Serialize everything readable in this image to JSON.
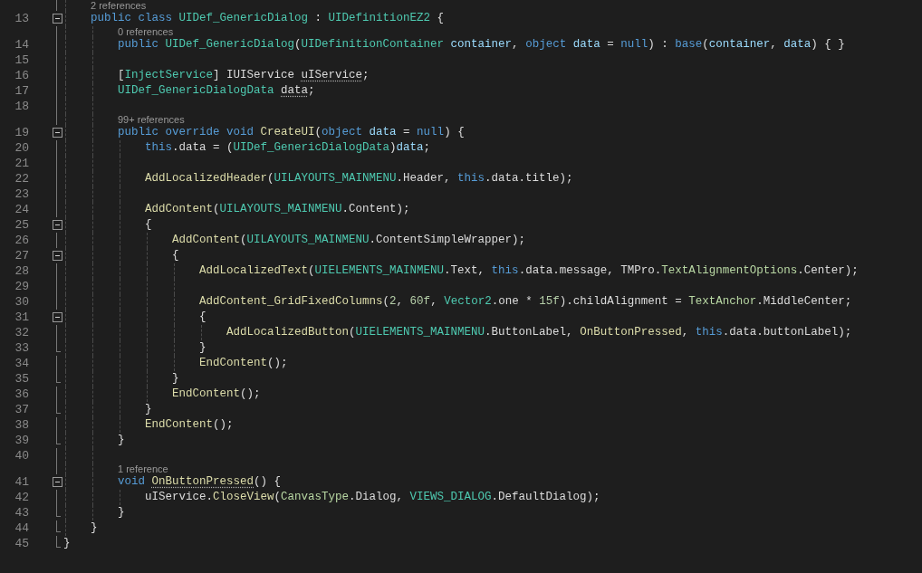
{
  "editor": {
    "lines": [
      {
        "kind": "block",
        "children": [
          {
            "kind": "codelens",
            "text": "2 references"
          },
          {
            "kind": "code",
            "number": "13",
            "expanded": true,
            "tokens": [
              {
                "text": "public class ",
                "kind": "keyword"
              },
              {
                "text": "UIDef_GenericDialog",
                "kind": "type"
              },
              {
                "text": " : ",
                "kind": "plain"
              },
              {
                "text": "UIDefinitionEZ2",
                "kind": "type"
              },
              {
                "text": " {",
                "kind": "plain"
              }
            ],
            "children": [
              {
                "kind": "codelens",
                "text": "0 references"
              },
              {
                "kind": "code",
                "number": "14",
                "tokens": [
                  {
                    "text": "public ",
                    "kind": "keyword"
                  },
                  {
                    "text": "UIDef_GenericDialog",
                    "kind": "type"
                  },
                  {
                    "text": "(",
                    "kind": "plain"
                  },
                  {
                    "text": "UIDefinitionContainer ",
                    "kind": "type"
                  },
                  {
                    "text": "container",
                    "kind": "param"
                  },
                  {
                    "text": ", ",
                    "kind": "plain"
                  },
                  {
                    "text": "object ",
                    "kind": "keyword"
                  },
                  {
                    "text": "data",
                    "kind": "param"
                  },
                  {
                    "text": " = ",
                    "kind": "plain"
                  },
                  {
                    "text": "null",
                    "kind": "keyword"
                  },
                  {
                    "text": ") : ",
                    "kind": "plain"
                  },
                  {
                    "text": "base",
                    "kind": "keyword"
                  },
                  {
                    "text": "(",
                    "kind": "plain"
                  },
                  {
                    "text": "container",
                    "kind": "param"
                  },
                  {
                    "text": ", ",
                    "kind": "plain"
                  },
                  {
                    "text": "data",
                    "kind": "param"
                  },
                  {
                    "text": ") { }",
                    "kind": "plain"
                  }
                ]
              },
              {
                "kind": "code",
                "number": "15"
              },
              {
                "kind": "code",
                "number": "16",
                "tokens": [
                  {
                    "text": "[",
                    "kind": "plain"
                  },
                  {
                    "text": "InjectService",
                    "kind": "type"
                  },
                  {
                    "text": "] IUIService ",
                    "kind": "plain"
                  },
                  {
                    "text": "uIService",
                    "kind": "plain",
                    "hint": true
                  },
                  {
                    "text": ";",
                    "kind": "plain"
                  }
                ]
              },
              {
                "kind": "code",
                "number": "17",
                "tokens": [
                  {
                    "text": "UIDef_GenericDialogData ",
                    "kind": "type"
                  },
                  {
                    "text": "data",
                    "kind": "plain",
                    "hint": true
                  },
                  {
                    "text": ";",
                    "kind": "plain"
                  }
                ]
              },
              {
                "kind": "code",
                "number": "18"
              },
              {
                "kind": "codelens",
                "text": "99+ references"
              },
              {
                "kind": "code",
                "number": "19",
                "expanded": true,
                "tokens": [
                  {
                    "text": "public override void ",
                    "kind": "keyword"
                  },
                  {
                    "text": "CreateUI",
                    "kind": "method"
                  },
                  {
                    "text": "(",
                    "kind": "plain"
                  },
                  {
                    "text": "object ",
                    "kind": "keyword"
                  },
                  {
                    "text": "data",
                    "kind": "param"
                  },
                  {
                    "text": " = ",
                    "kind": "plain"
                  },
                  {
                    "text": "null",
                    "kind": "keyword"
                  },
                  {
                    "text": ") {",
                    "kind": "plain"
                  }
                ],
                "children": [
                  {
                    "kind": "code",
                    "number": "20",
                    "tokens": [
                      {
                        "text": "this",
                        "kind": "keyword"
                      },
                      {
                        "text": ".data = (",
                        "kind": "plain"
                      },
                      {
                        "text": "UIDef_GenericDialogData",
                        "kind": "type"
                      },
                      {
                        "text": ")",
                        "kind": "plain"
                      },
                      {
                        "text": "data",
                        "kind": "param"
                      },
                      {
                        "text": ";",
                        "kind": "plain"
                      }
                    ]
                  },
                  {
                    "kind": "code",
                    "number": "21"
                  },
                  {
                    "kind": "code",
                    "number": "22",
                    "tokens": [
                      {
                        "text": "AddLocalizedHeader",
                        "kind": "method"
                      },
                      {
                        "text": "(",
                        "kind": "plain"
                      },
                      {
                        "text": "UILAYOUTS_MAINMENU",
                        "kind": "type"
                      },
                      {
                        "text": ".Header, ",
                        "kind": "plain"
                      },
                      {
                        "text": "this",
                        "kind": "keyword"
                      },
                      {
                        "text": ".data.title);",
                        "kind": "plain"
                      }
                    ]
                  },
                  {
                    "kind": "code",
                    "number": "23"
                  },
                  {
                    "kind": "code",
                    "number": "24",
                    "tokens": [
                      {
                        "text": "AddContent",
                        "kind": "method"
                      },
                      {
                        "text": "(",
                        "kind": "plain"
                      },
                      {
                        "text": "UILAYOUTS_MAINMENU",
                        "kind": "type"
                      },
                      {
                        "text": ".Content);",
                        "kind": "plain"
                      }
                    ]
                  },
                  {
                    "kind": "code",
                    "number": "25",
                    "expanded": true,
                    "tokens": [
                      {
                        "text": "{",
                        "kind": "plain"
                      }
                    ],
                    "children": [
                      {
                        "kind": "code",
                        "number": "26",
                        "tokens": [
                          {
                            "text": "AddContent",
                            "kind": "method"
                          },
                          {
                            "text": "(",
                            "kind": "plain"
                          },
                          {
                            "text": "UILAYOUTS_MAINMENU",
                            "kind": "type"
                          },
                          {
                            "text": ".ContentSimpleWrapper);",
                            "kind": "plain"
                          }
                        ]
                      },
                      {
                        "kind": "code",
                        "number": "27",
                        "expanded": true,
                        "tokens": [
                          {
                            "text": "{",
                            "kind": "plain"
                          }
                        ],
                        "children": [
                          {
                            "kind": "code",
                            "number": "28",
                            "tokens": [
                              {
                                "text": "AddLocalizedText",
                                "kind": "method"
                              },
                              {
                                "text": "(",
                                "kind": "plain"
                              },
                              {
                                "text": "UIELEMENTS_MAINMENU",
                                "kind": "type"
                              },
                              {
                                "text": ".Text, ",
                                "kind": "plain"
                              },
                              {
                                "text": "this",
                                "kind": "keyword"
                              },
                              {
                                "text": ".data.message, TMPro.",
                                "kind": "plain"
                              },
                              {
                                "text": "TextAlignmentOptions",
                                "kind": "enum"
                              },
                              {
                                "text": ".Center);",
                                "kind": "plain"
                              }
                            ]
                          },
                          {
                            "kind": "code",
                            "number": "29"
                          },
                          {
                            "kind": "code",
                            "number": "30",
                            "tokens": [
                              {
                                "text": "AddContent_GridFixedColumns",
                                "kind": "method"
                              },
                              {
                                "text": "(",
                                "kind": "plain"
                              },
                              {
                                "text": "2",
                                "kind": "number"
                              },
                              {
                                "text": ", ",
                                "kind": "plain"
                              },
                              {
                                "text": "60f",
                                "kind": "number"
                              },
                              {
                                "text": ", ",
                                "kind": "plain"
                              },
                              {
                                "text": "Vector2",
                                "kind": "type"
                              },
                              {
                                "text": ".one * ",
                                "kind": "plain"
                              },
                              {
                                "text": "15f",
                                "kind": "number"
                              },
                              {
                                "text": ").childAlignment = ",
                                "kind": "plain"
                              },
                              {
                                "text": "TextAnchor",
                                "kind": "enum"
                              },
                              {
                                "text": ".MiddleCenter;",
                                "kind": "plain"
                              }
                            ]
                          },
                          {
                            "kind": "code",
                            "number": "31",
                            "expanded": true,
                            "tokens": [
                              {
                                "text": "{",
                                "kind": "plain"
                              }
                            ],
                            "children": [
                              {
                                "kind": "code",
                                "number": "32",
                                "tokens": [
                                  {
                                    "text": "AddLocalizedButton",
                                    "kind": "method"
                                  },
                                  {
                                    "text": "(",
                                    "kind": "plain"
                                  },
                                  {
                                    "text": "UIELEMENTS_MAINMENU",
                                    "kind": "type"
                                  },
                                  {
                                    "text": ".ButtonLabel, ",
                                    "kind": "plain"
                                  },
                                  {
                                    "text": "OnButtonPressed",
                                    "kind": "method"
                                  },
                                  {
                                    "text": ", ",
                                    "kind": "plain"
                                  },
                                  {
                                    "text": "this",
                                    "kind": "keyword"
                                  },
                                  {
                                    "text": ".data.buttonLabel);",
                                    "kind": "plain"
                                  }
                                ]
                              }
                            ]
                          },
                          {
                            "kind": "code",
                            "number": "33",
                            "fold_end": true,
                            "tokens": [
                              {
                                "text": "}",
                                "kind": "plain"
                              }
                            ]
                          },
                          {
                            "kind": "code",
                            "number": "34",
                            "tokens": [
                              {
                                "text": "EndContent",
                                "kind": "method"
                              },
                              {
                                "text": "();",
                                "kind": "plain"
                              }
                            ]
                          }
                        ]
                      },
                      {
                        "kind": "code",
                        "number": "35",
                        "fold_end": true,
                        "tokens": [
                          {
                            "text": "}",
                            "kind": "plain"
                          }
                        ]
                      },
                      {
                        "kind": "code",
                        "number": "36",
                        "tokens": [
                          {
                            "text": "EndContent",
                            "kind": "method"
                          },
                          {
                            "text": "();",
                            "kind": "plain"
                          }
                        ]
                      }
                    ]
                  },
                  {
                    "kind": "code",
                    "number": "37",
                    "fold_end": true,
                    "tokens": [
                      {
                        "text": "}",
                        "kind": "plain"
                      }
                    ]
                  },
                  {
                    "kind": "code",
                    "number": "38",
                    "tokens": [
                      {
                        "text": "EndContent",
                        "kind": "method"
                      },
                      {
                        "text": "();",
                        "kind": "plain"
                      }
                    ]
                  }
                ]
              },
              {
                "kind": "code",
                "number": "39",
                "fold_end": true,
                "tokens": [
                  {
                    "text": "}",
                    "kind": "plain"
                  }
                ]
              },
              {
                "kind": "code",
                "number": "40"
              },
              {
                "kind": "codelens",
                "text": "1 reference"
              },
              {
                "kind": "code",
                "number": "41",
                "expanded": true,
                "tokens": [
                  {
                    "text": "void ",
                    "kind": "keyword"
                  },
                  {
                    "text": "OnButtonPressed",
                    "kind": "method",
                    "hint": true
                  },
                  {
                    "text": "() {",
                    "kind": "plain"
                  }
                ],
                "children": [
                  {
                    "kind": "code",
                    "number": "42",
                    "tokens": [
                      {
                        "text": "uIService.",
                        "kind": "plain"
                      },
                      {
                        "text": "CloseView",
                        "kind": "method"
                      },
                      {
                        "text": "(",
                        "kind": "plain"
                      },
                      {
                        "text": "CanvasType",
                        "kind": "enum"
                      },
                      {
                        "text": ".Dialog, ",
                        "kind": "plain"
                      },
                      {
                        "text": "VIEWS_DIALOG",
                        "kind": "type"
                      },
                      {
                        "text": ".DefaultDialog);",
                        "kind": "plain"
                      }
                    ]
                  }
                ]
              },
              {
                "kind": "code",
                "number": "43",
                "fold_end": true,
                "tokens": [
                  {
                    "text": "}",
                    "kind": "plain"
                  }
                ]
              }
            ]
          },
          {
            "kind": "code",
            "number": "44",
            "fold_end": true,
            "tokens": [
              {
                "text": "}",
                "kind": "plain"
              }
            ]
          }
        ]
      },
      {
        "kind": "code",
        "number": "45",
        "fold_end": true,
        "tokens": [
          {
            "text": "}",
            "kind": "plain"
          }
        ]
      }
    ]
  }
}
